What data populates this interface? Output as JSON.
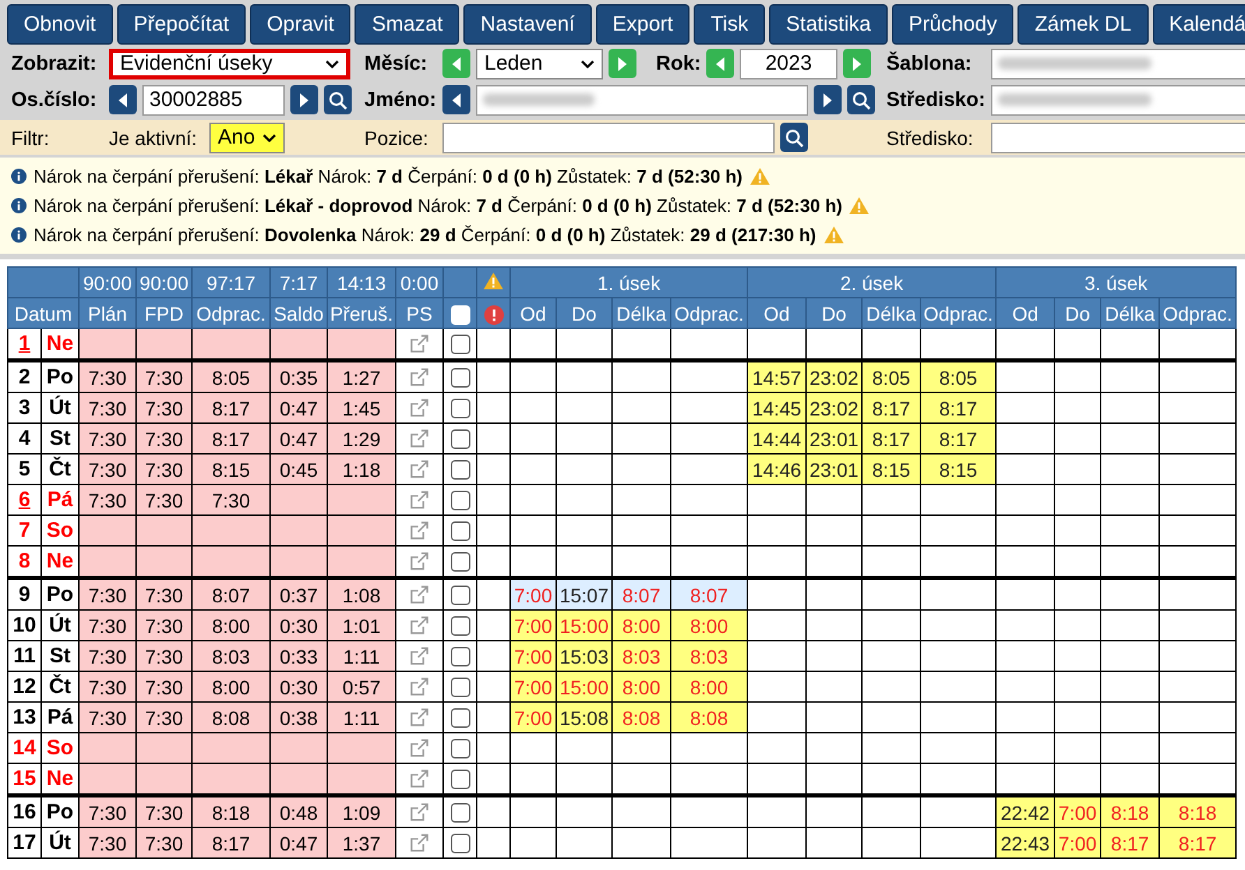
{
  "toolbar": [
    "Obnovit",
    "Přepočítat",
    "Opravit",
    "Smazat",
    "Nastavení",
    "Export",
    "Tisk",
    "Statistika",
    "Průchody",
    "Zámek DL",
    "Kalendá"
  ],
  "form": {
    "display": {
      "label": "Zobrazit:",
      "value": "Evidenční úseky",
      "highlighted": true
    },
    "month": {
      "label": "Měsíc:",
      "value": "Leden"
    },
    "year": {
      "label": "Rok:",
      "value": "2023"
    },
    "template": {
      "label": "Šablona:"
    },
    "employee_no": {
      "label": "Os.číslo:",
      "value": "30002885"
    },
    "name": {
      "label": "Jméno:"
    },
    "center": {
      "label": "Středisko:"
    }
  },
  "filter": {
    "label": "Filtr:",
    "active": {
      "label": "Je aktivní:",
      "value": "Ano"
    },
    "position": {
      "label": "Pozice:"
    },
    "center": {
      "label": "Středisko:"
    }
  },
  "notices": [
    "Nárok na čerpání přerušení: **Lékař** Nárok: **7 d** Čerpání: **0 d (0 h)** Zůstatek: **7 d (52:30 h)**",
    "Nárok na čerpání přerušení: **Lékař - doprovod** Nárok: **7 d** Čerpání: **0 d (0 h)** Zůstatek: **7 d (52:30 h)**",
    "Nárok na čerpání přerušení: **Dovolenka** Nárok: **29 d** Čerpání: **0 d (0 h)** Zůstatek: **29 d (217:30 h)**"
  ],
  "table": {
    "totals": [
      "90:00",
      "90:00",
      "97:17",
      "7:17",
      "14:13",
      "0:00"
    ],
    "columns": [
      "Datum",
      "Plán",
      "FPD",
      "Odprac.",
      "Saldo",
      "Přeruš.",
      "PS"
    ],
    "header_checkbox": {
      "checked": false
    },
    "segments": [
      {
        "title": "1. úsek",
        "columns": [
          "Od",
          "Do",
          "Délka",
          "Odprac."
        ]
      },
      {
        "title": "2. úsek",
        "columns": [
          "Od",
          "Do",
          "Délka",
          "Odprac."
        ]
      },
      {
        "title": "3. úsek",
        "columns": [
          "Od",
          "Do",
          "Délka",
          "Odprac."
        ]
      }
    ],
    "rows": [
      {
        "day": "1",
        "weekday": "Ne",
        "day_off": true,
        "holiday": true,
        "week_break": true,
        "checked": false
      },
      {
        "day": "2",
        "weekday": "Po",
        "day_off": false,
        "holiday": false,
        "week_break": false,
        "checked": false,
        "values": [
          "7:30",
          "7:30",
          "8:05",
          "0:35",
          "1:27"
        ],
        "segment_2": {
          "color": "#ffff80",
          "cells": [
            {
              "text": "14:57",
              "alert": false
            },
            {
              "text": "23:02",
              "alert": false
            },
            {
              "text": "8:05",
              "alert": false
            },
            {
              "text": "8:05",
              "alert": false
            }
          ]
        }
      },
      {
        "day": "3",
        "weekday": "Út",
        "day_off": false,
        "holiday": false,
        "week_break": false,
        "checked": false,
        "values": [
          "7:30",
          "7:30",
          "8:17",
          "0:47",
          "1:45"
        ],
        "segment_2": {
          "color": "#ffff80",
          "cells": [
            {
              "text": "14:45",
              "alert": false
            },
            {
              "text": "23:02",
              "alert": false
            },
            {
              "text": "8:17",
              "alert": false
            },
            {
              "text": "8:17",
              "alert": false
            }
          ]
        }
      },
      {
        "day": "4",
        "weekday": "St",
        "day_off": false,
        "holiday": false,
        "week_break": false,
        "checked": false,
        "values": [
          "7:30",
          "7:30",
          "8:17",
          "0:47",
          "1:29"
        ],
        "segment_2": {
          "color": "#ffff80",
          "cells": [
            {
              "text": "14:44",
              "alert": false
            },
            {
              "text": "23:01",
              "alert": false
            },
            {
              "text": "8:17",
              "alert": false
            },
            {
              "text": "8:17",
              "alert": false
            }
          ]
        }
      },
      {
        "day": "5",
        "weekday": "Čt",
        "day_off": false,
        "holiday": false,
        "week_break": false,
        "checked": false,
        "values": [
          "7:30",
          "7:30",
          "8:15",
          "0:45",
          "1:18"
        ],
        "segment_2": {
          "color": "#ffff80",
          "cells": [
            {
              "text": "14:46",
              "alert": false
            },
            {
              "text": "23:01",
              "alert": false
            },
            {
              "text": "8:15",
              "alert": false
            },
            {
              "text": "8:15",
              "alert": false
            }
          ]
        }
      },
      {
        "day": "6",
        "weekday": "Pá",
        "day_off": true,
        "holiday": true,
        "week_break": false,
        "checked": false,
        "values": [
          "7:30",
          "7:30",
          "7:30"
        ]
      },
      {
        "day": "7",
        "weekday": "So",
        "day_off": true,
        "holiday": false,
        "week_break": false,
        "checked": false
      },
      {
        "day": "8",
        "weekday": "Ne",
        "day_off": true,
        "holiday": false,
        "week_break": true,
        "checked": false
      },
      {
        "day": "9",
        "weekday": "Po",
        "day_off": false,
        "holiday": false,
        "week_break": false,
        "checked": false,
        "values": [
          "7:30",
          "7:30",
          "8:07",
          "0:37",
          "1:08"
        ],
        "segment_1": {
          "color": "#ddeeff",
          "cells": [
            {
              "text": "7:00",
              "alert": true
            },
            {
              "text": "15:07",
              "alert": false
            },
            {
              "text": "8:07",
              "alert": true
            },
            {
              "text": "8:07",
              "alert": true
            }
          ]
        }
      },
      {
        "day": "10",
        "weekday": "Út",
        "day_off": false,
        "holiday": false,
        "week_break": false,
        "checked": false,
        "values": [
          "7:30",
          "7:30",
          "8:00",
          "0:30",
          "1:01"
        ],
        "segment_1": {
          "color": "#ffff80",
          "cells": [
            {
              "text": "7:00",
              "alert": true
            },
            {
              "text": "15:00",
              "alert": true
            },
            {
              "text": "8:00",
              "alert": true
            },
            {
              "text": "8:00",
              "alert": true
            }
          ]
        }
      },
      {
        "day": "11",
        "weekday": "St",
        "day_off": false,
        "holiday": false,
        "week_break": false,
        "checked": false,
        "values": [
          "7:30",
          "7:30",
          "8:03",
          "0:33",
          "1:11"
        ],
        "segment_1": {
          "color": "#ffff80",
          "cells": [
            {
              "text": "7:00",
              "alert": true
            },
            {
              "text": "15:03",
              "alert": false
            },
            {
              "text": "8:03",
              "alert": true
            },
            {
              "text": "8:03",
              "alert": true
            }
          ]
        }
      },
      {
        "day": "12",
        "weekday": "Čt",
        "day_off": false,
        "holiday": false,
        "week_break": false,
        "checked": false,
        "values": [
          "7:30",
          "7:30",
          "8:00",
          "0:30",
          "0:57"
        ],
        "segment_1": {
          "color": "#ffff80",
          "cells": [
            {
              "text": "7:00",
              "alert": true
            },
            {
              "text": "15:00",
              "alert": true
            },
            {
              "text": "8:00",
              "alert": true
            },
            {
              "text": "8:00",
              "alert": true
            }
          ]
        }
      },
      {
        "day": "13",
        "weekday": "Pá",
        "day_off": false,
        "holiday": false,
        "week_break": false,
        "checked": false,
        "values": [
          "7:30",
          "7:30",
          "8:08",
          "0:38",
          "1:11"
        ],
        "segment_1": {
          "color": "#ffff80",
          "cells": [
            {
              "text": "7:00",
              "alert": true
            },
            {
              "text": "15:08",
              "alert": false
            },
            {
              "text": "8:08",
              "alert": true
            },
            {
              "text": "8:08",
              "alert": true
            }
          ]
        }
      },
      {
        "day": "14",
        "weekday": "So",
        "day_off": true,
        "holiday": false,
        "week_break": false,
        "checked": false
      },
      {
        "day": "15",
        "weekday": "Ne",
        "day_off": true,
        "holiday": false,
        "week_break": true,
        "checked": false
      },
      {
        "day": "16",
        "weekday": "Po",
        "day_off": false,
        "holiday": false,
        "week_break": false,
        "checked": false,
        "values": [
          "7:30",
          "7:30",
          "8:18",
          "0:48",
          "1:09"
        ],
        "segment_3": {
          "color": "#ffff80",
          "cells": [
            {
              "text": "22:42",
              "alert": false
            },
            {
              "text": "7:00",
              "alert": true
            },
            {
              "text": "8:18",
              "alert": true
            },
            {
              "text": "8:18",
              "alert": true
            }
          ]
        }
      },
      {
        "day": "17",
        "weekday": "Út",
        "day_off": false,
        "holiday": false,
        "week_break": false,
        "checked": false,
        "values": [
          "7:30",
          "7:30",
          "8:17",
          "0:47",
          "1:37"
        ],
        "segment_3": {
          "color": "#ffff80",
          "cells": [
            {
              "text": "22:43",
              "alert": false
            },
            {
              "text": "7:00",
              "alert": true
            },
            {
              "text": "8:17",
              "alert": true
            },
            {
              "text": "8:17",
              "alert": true
            }
          ]
        }
      }
    ]
  }
}
